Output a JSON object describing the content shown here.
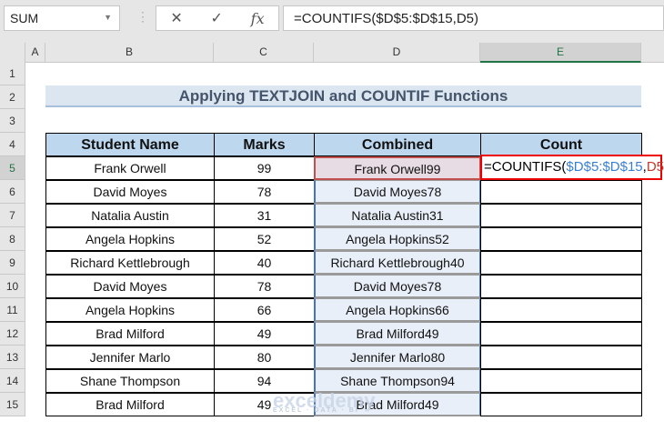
{
  "name_box": "SUM",
  "formula_bar": "=COUNTIFS($D$5:$D$15,D5)",
  "columns": [
    "A",
    "B",
    "C",
    "D",
    "E"
  ],
  "rows": [
    "1",
    "2",
    "3",
    "4",
    "5",
    "6",
    "7",
    "8",
    "9",
    "10",
    "11",
    "12",
    "13",
    "14",
    "15"
  ],
  "title": "Applying TEXTJOIN and COUNTIF Functions",
  "headers": [
    "Student Name",
    "Marks",
    "Combined",
    "Count"
  ],
  "data": [
    [
      "Frank Orwell",
      "99",
      "Frank Orwell99"
    ],
    [
      "David Moyes",
      "78",
      "David Moyes78"
    ],
    [
      "Natalia Austin",
      "31",
      "Natalia Austin31"
    ],
    [
      "Angela Hopkins",
      "52",
      "Angela Hopkins52"
    ],
    [
      "Richard Kettlebrough",
      "40",
      "Richard Kettlebrough40"
    ],
    [
      "David Moyes",
      "78",
      "David Moyes78"
    ],
    [
      "Angela Hopkins",
      "66",
      "Angela Hopkins66"
    ],
    [
      "Brad Milford",
      "49",
      "Brad Milford49"
    ],
    [
      "Jennifer Marlo",
      "80",
      "Jennifer Marlo80"
    ],
    [
      "Shane Thompson",
      "94",
      "Shane Thompson94"
    ],
    [
      "Brad Milford",
      "49",
      "Brad Milford49"
    ]
  ],
  "edit_formula": {
    "p1": "=COUNTIFS(",
    "p2": "$D$5:$D$15",
    ",": ",",
    "p3": "D5",
    "p4": ")"
  },
  "watermark": {
    "name": "exceldemy",
    "tag": "EXCEL · DATA · BI"
  }
}
